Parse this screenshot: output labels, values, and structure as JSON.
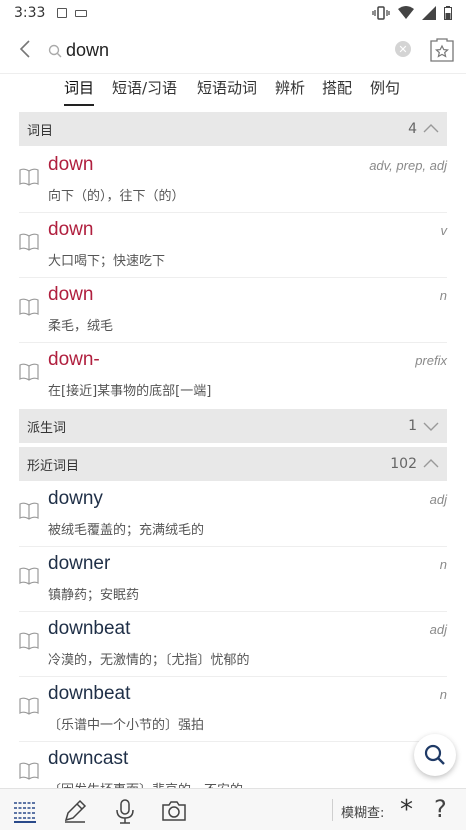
{
  "status": {
    "time": "3:33"
  },
  "search": {
    "value": "down",
    "placeholder": ""
  },
  "tabs": [
    {
      "label": "词目"
    },
    {
      "label": "短语/习语"
    },
    {
      "label": "短语动词"
    },
    {
      "label": "辨析"
    },
    {
      "label": "搭配"
    },
    {
      "label": "例句"
    }
  ],
  "sections": {
    "headwords": {
      "title": "词目",
      "count": "4",
      "expanded": true
    },
    "derived": {
      "title": "派生词",
      "count": "1",
      "expanded": false
    },
    "similar": {
      "title": "形近词目",
      "count": "102",
      "expanded": true
    }
  },
  "headword_entries": [
    {
      "word": "down",
      "pos": "adv, prep, adj",
      "def": "向下（的），往下（的）"
    },
    {
      "word": "down",
      "pos": "v",
      "def": "大口喝下；快速吃下"
    },
    {
      "word": "down",
      "pos": "n",
      "def": "柔毛，绒毛"
    },
    {
      "word": "down-",
      "pos": "prefix",
      "def": "在[接近]某事物的底部[一端]"
    }
  ],
  "similar_entries": [
    {
      "word": "downy",
      "pos": "adj",
      "def": "被绒毛覆盖的；充满绒毛的"
    },
    {
      "word": "downer",
      "pos": "n",
      "def": "镇静药；安眠药"
    },
    {
      "word": "downbeat",
      "pos": "adj",
      "def": "冷漠的，无激情的；〔尤指〕忧郁的"
    },
    {
      "word": "downbeat",
      "pos": "n",
      "def": "〔乐谱中一个小节的〕强拍"
    },
    {
      "word": "downcast",
      "pos": "",
      "def": "〔因发生坏事而〕悲哀的，不安的"
    }
  ],
  "bottom": {
    "fuzzy_label": "模糊查:",
    "wildcard": "*",
    "help": "?"
  },
  "colors": {
    "accent": "#b01f3e",
    "word": "#1f2f47",
    "section_bg": "#e8e8e8"
  }
}
